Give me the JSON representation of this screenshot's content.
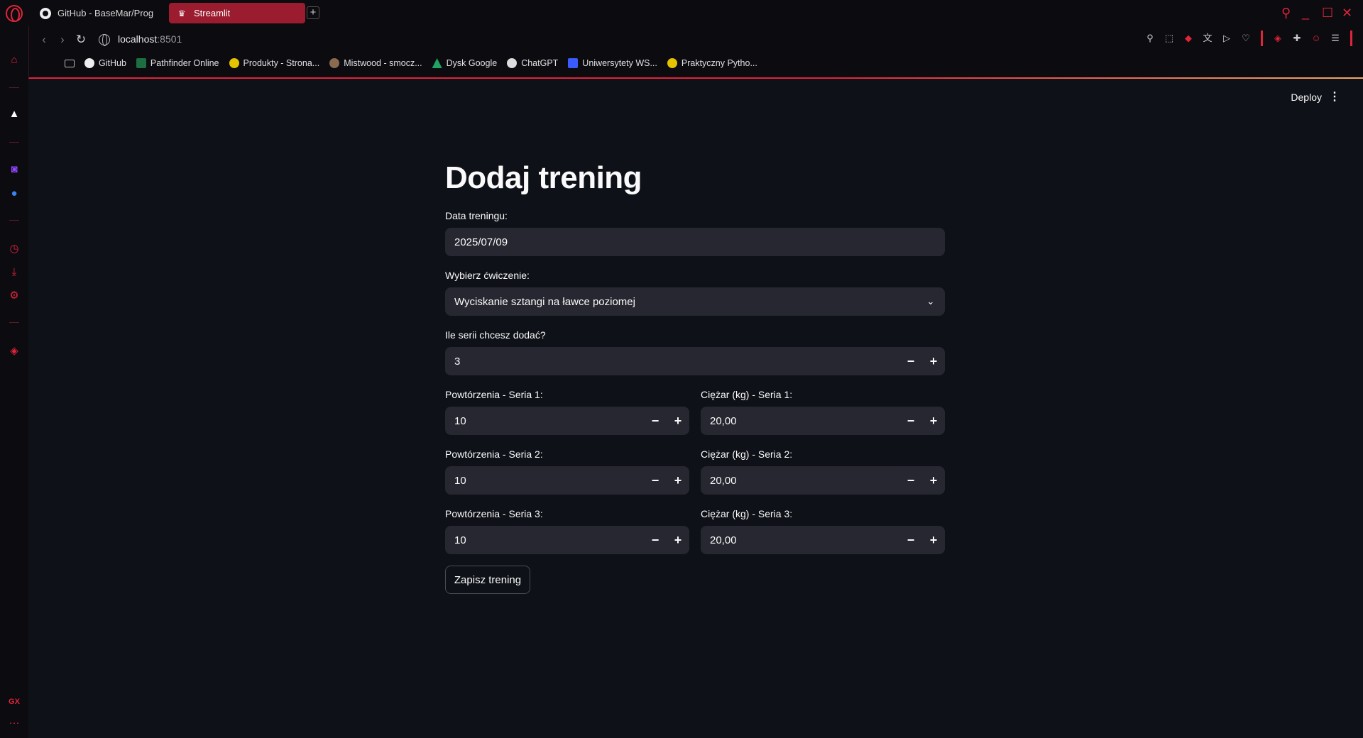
{
  "browser": {
    "tabs": [
      {
        "label": "GitHub - BaseMar/Progres",
        "icon": "github-icon"
      },
      {
        "label": "Streamlit",
        "icon": "streamlit-icon",
        "active": true
      }
    ],
    "new_tab": "+",
    "address": {
      "host": "localhost",
      "port": ":8501"
    },
    "bookmarks": [
      {
        "label": "GitHub",
        "icon": "github-icon",
        "color": "#eeeeee"
      },
      {
        "label": "Pathfinder Online",
        "icon": "excel-icon",
        "color": "#1d6f42"
      },
      {
        "label": "Produkty - Strona...",
        "icon": "python-icon",
        "color": "#e6c300"
      },
      {
        "label": "Mistwood - smocz...",
        "icon": "dragon-icon",
        "color": "#8a6a50"
      },
      {
        "label": "Dysk Google",
        "icon": "drive-icon",
        "color": "#1fa463"
      },
      {
        "label": "ChatGPT",
        "icon": "chatgpt-icon",
        "color": "#dddddd"
      },
      {
        "label": "Uniwersytety WS...",
        "icon": "m-icon",
        "color": "#3a5bff"
      },
      {
        "label": "Praktyczny Pytho...",
        "icon": "python-icon",
        "color": "#e6c300"
      }
    ],
    "accent": "#e0243a"
  },
  "header": {
    "deploy_label": "Deploy"
  },
  "form": {
    "title": "Dodaj trening",
    "date": {
      "label": "Data treningu:",
      "value": "2025/07/09"
    },
    "exercise": {
      "label": "Wybierz ćwiczenie:",
      "value": "Wyciskanie sztangi na ławce poziomej"
    },
    "series_count": {
      "label": "Ile serii chcesz dodać?",
      "value": "3"
    },
    "series": [
      {
        "reps_label": "Powtórzenia - Seria 1:",
        "reps": "10",
        "weight_label": "Ciężar (kg) - Seria 1:",
        "weight": "20,00"
      },
      {
        "reps_label": "Powtórzenia - Seria 2:",
        "reps": "10",
        "weight_label": "Ciężar (kg) - Seria 2:",
        "weight": "20,00"
      },
      {
        "reps_label": "Powtórzenia - Seria 3:",
        "reps": "10",
        "weight_label": "Ciężar (kg) - Seria 3:",
        "weight": "20,00"
      }
    ],
    "save_label": "Zapisz trening",
    "minus": "−",
    "plus": "+"
  },
  "sidebar_rail": {
    "bottom_label": "GX",
    "more": "···"
  }
}
